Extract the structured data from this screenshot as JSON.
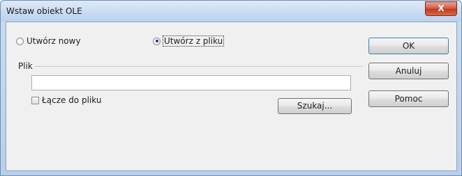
{
  "window": {
    "title": "Wstaw obiekt OLE",
    "close_label": "X"
  },
  "options": {
    "create_new": "Utwórz nowy",
    "create_from_file": "Utwórz z pliku",
    "selected": "Utwórz z pliku"
  },
  "file_group": {
    "label": "Plik",
    "input_value": "",
    "link_checkbox_label": "Łącze do pliku",
    "link_checked": false,
    "browse_label": "Szukaj..."
  },
  "buttons": {
    "ok": "OK",
    "cancel": "Anuluj",
    "help": "Pomoc"
  }
}
